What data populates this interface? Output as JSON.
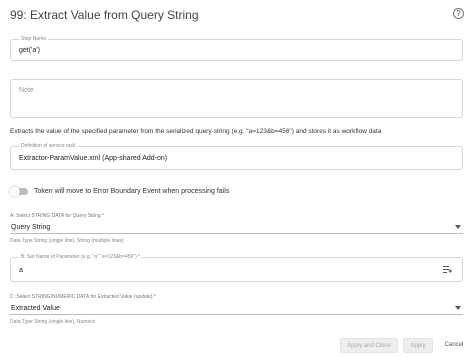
{
  "dialog": {
    "title": "99: Extract Value from Query String",
    "help_icon": "?"
  },
  "step_name": {
    "label": "Step Name",
    "value": "get('a')"
  },
  "note": {
    "placeholder": "Note"
  },
  "description": "Extracts the value of the specified parameter from the serialized query-string (e.g. \"a=123&b=456\") and stores it as workflow data",
  "service_task": {
    "label": "Definition of service task",
    "value": "Extractor-ParamValue.xml (App-shared Add-on)"
  },
  "toggle": {
    "label": "Token will move to Error Boundary Event when processing fails",
    "checked": false
  },
  "field_a": {
    "label": "A: Select STRING DATA for Query String *",
    "value": "Query String",
    "hint": "Data Type String (single line), String (multiple lines)"
  },
  "field_b": {
    "label": "B: Set Name of Parameter (e.g. \"a\" \"a=123&b=456\") *",
    "value": "a"
  },
  "field_c": {
    "label": "C: Select STRING/NUMERIC DATA for Extracted Value (update) *",
    "value": "Extracted Value",
    "hint": "Data Type String (single line), Numeric"
  },
  "buttons": {
    "apply_close": "Apply and Close",
    "apply": "Apply",
    "cancel": "Cancel"
  }
}
